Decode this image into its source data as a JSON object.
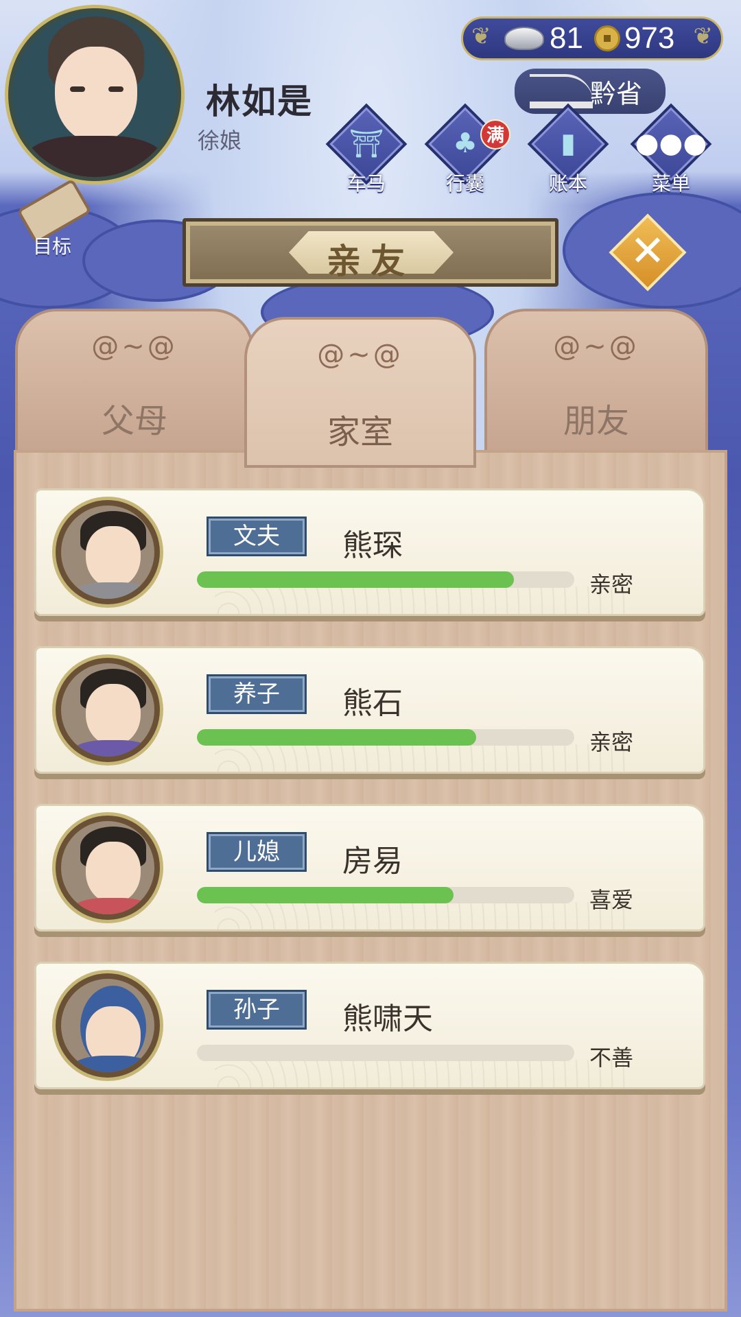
{
  "player": {
    "name": "林如是",
    "title": "徐娘"
  },
  "currency": {
    "silver": "81",
    "copper": "973"
  },
  "location": {
    "label": "黔省"
  },
  "menu": [
    {
      "key": "carriage",
      "label": "车马",
      "icon": "carriage-icon"
    },
    {
      "key": "bag",
      "label": "行囊",
      "icon": "bundle-icon",
      "badge": "满"
    },
    {
      "key": "ledger",
      "label": "账本",
      "icon": "ledger-icon"
    },
    {
      "key": "more",
      "label": "菜单",
      "icon": "more-dots-icon"
    }
  ],
  "goal": {
    "label": "目标"
  },
  "panel": {
    "title": "亲友"
  },
  "tabs": [
    {
      "label": "父母",
      "active": false
    },
    {
      "label": "家室",
      "active": true
    },
    {
      "label": "朋友",
      "active": false
    }
  ],
  "relatives": [
    {
      "relation": "文夫",
      "name": "熊琛",
      "status": "亲密",
      "affinity": 0.84
    },
    {
      "relation": "养子",
      "name": "熊石",
      "status": "亲密",
      "affinity": 0.74
    },
    {
      "relation": "儿媳",
      "name": "房易",
      "status": "喜爱",
      "affinity": 0.68
    },
    {
      "relation": "孙子",
      "name": "熊啸天",
      "status": "不善",
      "affinity": 0.0
    }
  ],
  "colors": {
    "bar_fill": "#6cc251",
    "relation_tag": "#4f6e95",
    "badge": "#d33838"
  }
}
